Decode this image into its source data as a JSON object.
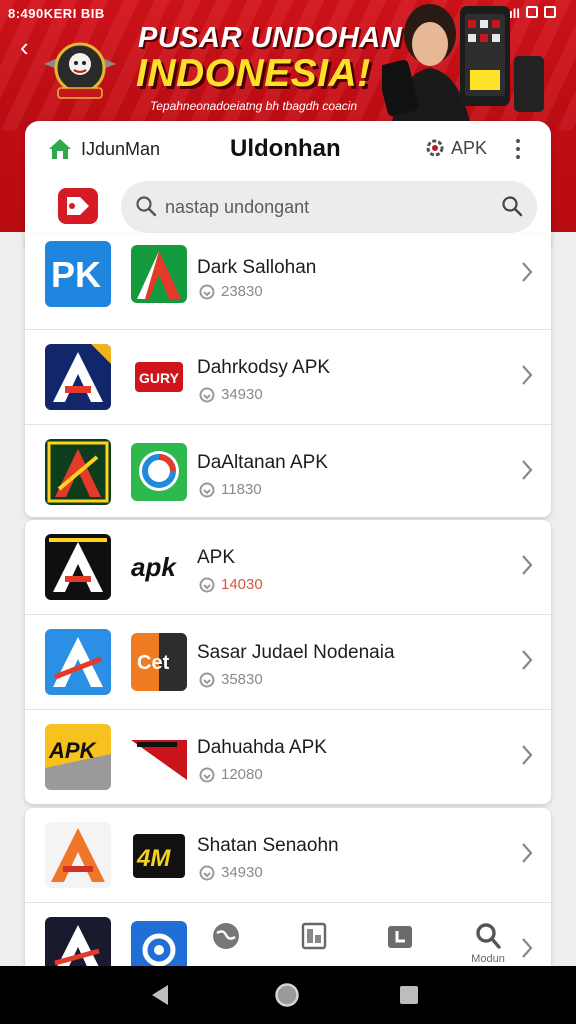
{
  "status_bar": {
    "left_text": "8:490KERI BIB",
    "right_text": "ıll"
  },
  "banner": {
    "headline_1": "PUSAR UNDOHAN",
    "headline_2": "INDONESIA!",
    "subtitle": "Tepahneonadoeiatng bh tbagdh coacin",
    "colors": {
      "background": "#d3121a",
      "headline_2": "#ffe12c"
    }
  },
  "header": {
    "brand_label": "IJdunMan",
    "title": "Uldonhan",
    "apk_label": "APK",
    "icons": [
      "home-icon",
      "gear-icon",
      "more-icon",
      "red-app-icon"
    ]
  },
  "search": {
    "placeholder": "nastap undongant"
  },
  "list_cards": [
    {
      "rows": [
        {
          "title": "Dark Sallohan",
          "meta": "23830",
          "icon_left": "apk-blue-icon",
          "icon_right": "green-a-icon"
        },
        {
          "title": "Dahrkodsy APK",
          "meta": "34930",
          "icon_left": "navy-a-icon",
          "icon_right": "red-badge-icon"
        },
        {
          "title": "DaAltanan APK",
          "meta": "11830",
          "icon_left": "green-a-icon",
          "icon_right": "chat-swirl-icon"
        }
      ]
    },
    {
      "rows": [
        {
          "title": "APK",
          "meta": "14030",
          "meta_hot": true,
          "icon_left": "black-a-icon",
          "icon_right": "apk-text-icon"
        },
        {
          "title": "Sasar Judael Nodenaia",
          "meta": "35830",
          "icon_left": "blue-a-icon",
          "icon_right": "orange-c-icon"
        },
        {
          "title": "Dahuahda APK",
          "meta": "12080",
          "icon_left": "yellow-apk-icon",
          "icon_right": "red-tag-icon"
        }
      ]
    },
    {
      "rows": [
        {
          "title": "Shatan Senaohn",
          "meta": "34930",
          "icon_left": "orange-a-icon",
          "icon_right": "yellow-4m-icon"
        }
      ]
    }
  ],
  "bottom_tabs": [
    {
      "icon": "globe-icon",
      "label": ""
    },
    {
      "icon": "document-icon",
      "label": ""
    },
    {
      "icon": "download-icon",
      "label": ""
    },
    {
      "icon": "search-icon",
      "label": "Modun"
    }
  ],
  "system_nav": {
    "icons": [
      "back-triangle-icon",
      "home-circle-icon",
      "recents-square-icon"
    ]
  }
}
